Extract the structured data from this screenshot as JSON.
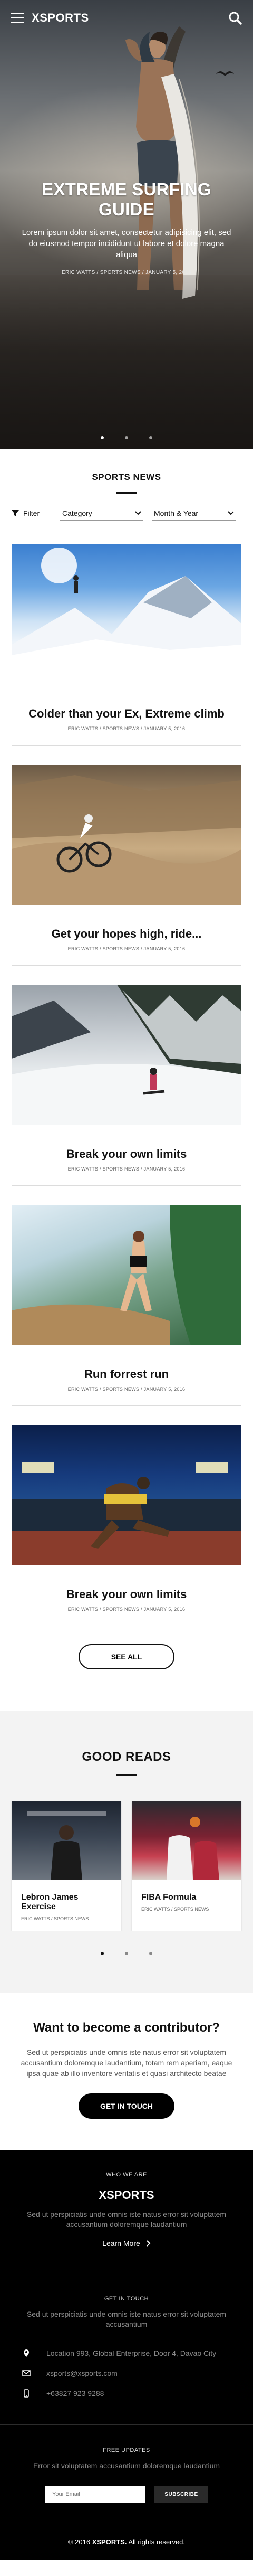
{
  "brand": {
    "name": "XSPORTS"
  },
  "hero": {
    "title": "EXTREME SURFING GUIDE",
    "description": "Lorem ipsum dolor sit amet, consectetur adipisicing elit, sed do eiusmod tempor incididunt ut labore et dolore magna aliqua",
    "meta": "ERIC WATTS / SPORTS NEWS / JANUARY 5, 2016",
    "slide_count": 3,
    "active_slide": 0
  },
  "sports_news": {
    "title": "SPORTS NEWS",
    "filter_label": "Filter",
    "category_select": "Category",
    "month_select": "Month & Year",
    "items": [
      {
        "title": "Colder than your Ex, Extreme climb",
        "meta": "ERIC WATTS / SPORTS NEWS / JANUARY 5, 2016",
        "image": "mountain-climber"
      },
      {
        "title": "Get your hopes high, ride...",
        "meta": "ERIC WATTS / SPORTS NEWS / JANUARY 5, 2016",
        "image": "mountain-biker"
      },
      {
        "title": "Break your own limits",
        "meta": "ERIC WATTS / SPORTS NEWS / JANUARY 5, 2016",
        "image": "snowboarder"
      },
      {
        "title": "Run forrest run",
        "meta": "ERIC WATTS / SPORTS NEWS / JANUARY 5, 2016",
        "image": "trail-runner"
      },
      {
        "title": "Break your own limits",
        "meta": "ERIC WATTS / SPORTS NEWS / JANUARY 5, 2016",
        "image": "sprinter-stadium"
      }
    ],
    "see_all_label": "SEE ALL"
  },
  "good_reads": {
    "title": "GOOD READS",
    "cards": [
      {
        "title": "Lebron James Exercise",
        "meta": "ERIC WATTS / SPORTS NEWS"
      },
      {
        "title": "FIBA Formula",
        "meta": "ERIC WATTS / SPORTS NEWS"
      }
    ],
    "slide_count": 3,
    "active_slide": 0
  },
  "contributor": {
    "title": "Want to become a contributor?",
    "text": "Sed ut perspiciatis unde omnis iste natus error sit voluptatem accusantium doloremque laudantium, totam rem aperiam, eaque ipsa quae ab illo inventore veritatis et quasi architecto beatae",
    "cta_label": "GET IN TOUCH"
  },
  "footer": {
    "who_heading": "WHO WE ARE",
    "logo": "XSPORTS",
    "who_text": "Sed ut perspiciatis unde omnis iste natus error sit voluptatem accusantium doloremque laudantium",
    "learn_more": "Learn More",
    "touch_heading": "GET IN TOUCH",
    "touch_text": "Sed ut perspiciatis unde omnis iste natus error sit voluptatem accusantium",
    "contacts": {
      "address": "Location 993, Global Enterprise, Door 4, Davao City",
      "email": "xsports@xsports.com",
      "phone": "+63827 923 9288"
    },
    "updates_heading": "FREE UPDATES",
    "updates_text": "Error sit voluptatem accusantium doloremque laudantium",
    "email_placeholder": "Your Email",
    "subscribe_label": "SUBSCRIBE",
    "copyright_prefix": "© 2016",
    "copyright_brand": "XSPORTS.",
    "copyright_suffix": "All rights reserved."
  }
}
